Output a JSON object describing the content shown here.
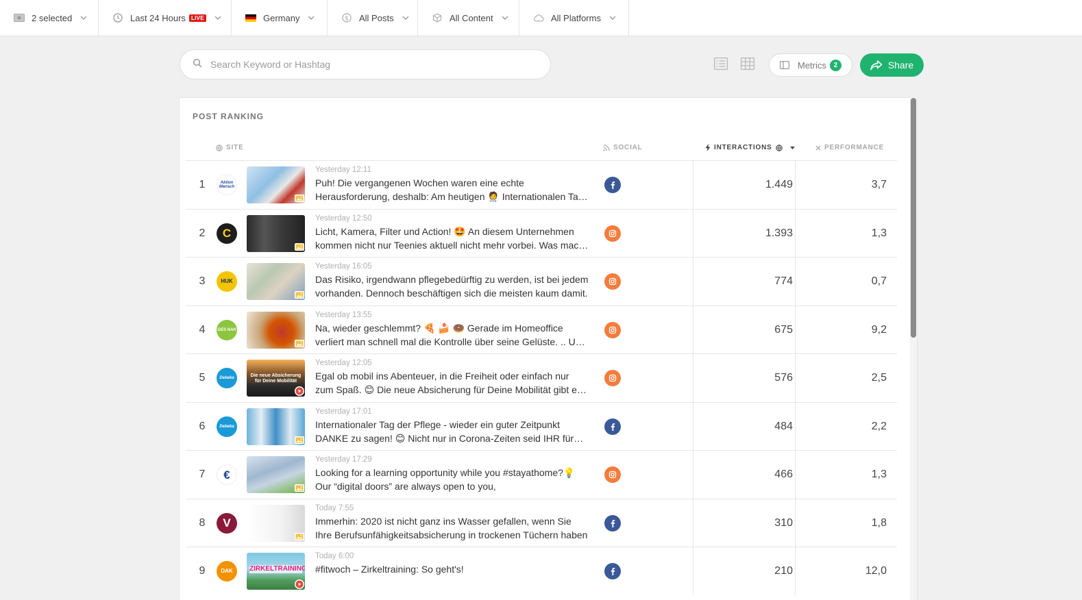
{
  "filters": [
    {
      "icon": "money-icon",
      "label": "2 selected",
      "live": false
    },
    {
      "icon": "clock-icon",
      "label": "Last 24 Hours",
      "live": true
    },
    {
      "icon": "germany-flag-icon",
      "label": "Germany",
      "live": false
    },
    {
      "icon": "dollar-icon",
      "label": "All Posts",
      "live": false
    },
    {
      "icon": "box-icon",
      "label": "All Content",
      "live": false
    },
    {
      "icon": "cloud-icon",
      "label": "All Platforms",
      "live": false
    }
  ],
  "live_label": "LIVE",
  "search": {
    "placeholder": "Search Keyword or Hashtag"
  },
  "metrics": {
    "label": "Metrics",
    "count": "2"
  },
  "share": {
    "label": "Share"
  },
  "panel": {
    "title": "POST RANKING"
  },
  "columns": {
    "site": "SITE",
    "social": "SOCIAL",
    "interactions": "INTERACTIONS",
    "performance": "PERFORMANCE"
  },
  "colors": {
    "accent": "#1fb36f",
    "facebook": "#3b5998",
    "instagram": "#f47c3c",
    "live": "#e01a1a"
  },
  "posts": [
    {
      "rank": "1",
      "site": "Aktion Mensch",
      "avatar_text": "Aktion Mensch",
      "avatar_bg": "#ffffff",
      "avatar_fg": "#2a4b9b",
      "thumb_type": "image",
      "thumb_bg": "linear-gradient(135deg,#cfe3f3 0%,#8fbfe3 40%,#e8e8e8 60%,#c0392b 75%,#dfe7ef 100%)",
      "time": "Yesterday 12:11",
      "text": "Puh! Die vergangenen Wochen waren eine echte Herausforderung, deshalb: Am heutigen 🧑‍⚕️ Internationalen Tag der Pflege möchten wir Danke sagen",
      "social": "facebook",
      "interactions": "1.449",
      "performance": "3,7"
    },
    {
      "rank": "2",
      "site": "Commerzbank",
      "avatar_text": "C",
      "avatar_bg": "#1d1d1d",
      "avatar_fg": "#f7d117",
      "thumb_type": "image",
      "thumb_bg": "linear-gradient(90deg,#2a2a2a 0%,#555 30%,#3a3a3a 60%,#222 100%)",
      "time": "Yesterday 12:50",
      "text": "Licht, Kamera, Filter und Action! 🤩 An diesem Unternehmen kommen nicht nur Teenies aktuell nicht mehr vorbei. Was macht TikTok so erfolgreich?",
      "social": "instagram",
      "interactions": "1.393",
      "performance": "1,3"
    },
    {
      "rank": "3",
      "site": "HUK-COBURG",
      "avatar_text": "HUK",
      "avatar_bg": "#f2c500",
      "avatar_fg": "#1b2a5c",
      "thumb_type": "image",
      "thumb_bg": "linear-gradient(135deg,#e9e3d6 0%,#b9c8b3 35%,#dcd2c2 60%,#7ea0b8 100%)",
      "time": "Yesterday 16:05",
      "text": "Das Risiko, irgendwann pflegebedürftig zu werden, ist bei jedem vorhanden. Dennoch beschäftigen sich die meisten kaum damit.",
      "social": "instagram",
      "interactions": "774",
      "performance": "0,7"
    },
    {
      "rank": "4",
      "site": "Gesund nah",
      "avatar_text": "GES NAH",
      "avatar_bg": "#8cc63f",
      "avatar_fg": "#ffffff",
      "thumb_type": "image",
      "thumb_bg": "radial-gradient(circle at 60% 55%,#c0392b 0%,#d35400 30%,#c9a77a 55%,#efe6d8 100%)",
      "time": "Yesterday 13:55",
      "text": "Na, wieder geschlemmt? 🍕 🍰 🍩 Gerade im Homeoffice verliert man schnell mal die Kontrolle über seine Gelüste. .. Um das zu vermeiden",
      "social": "instagram",
      "interactions": "675",
      "performance": "9,2"
    },
    {
      "rank": "5",
      "site": "Debeka",
      "avatar_text": "Debeka",
      "avatar_bg": "#1a9ad6",
      "avatar_fg": "#ffffff",
      "thumb_type": "video",
      "thumb_bg": "linear-gradient(180deg,#f3b25a 0%,#8a5a2b 35%,#2d2d2d 70%,#1a1a1a 100%)",
      "thumb_caption": "Die neue Absicherung für Deine Mobilität",
      "time": "Yesterday 12:05",
      "text": "Egal ob mobil ins Abenteuer, in die Freiheit oder einfach nur zum Spaß. 😊 Die neue Absicherung für Deine Mobilität gibt es jetzt",
      "social": "instagram",
      "interactions": "576",
      "performance": "2,5"
    },
    {
      "rank": "6",
      "site": "Debeka",
      "avatar_text": "Debeka",
      "avatar_bg": "#1a9ad6",
      "avatar_fg": "#ffffff",
      "thumb_type": "image",
      "thumb_bg": "linear-gradient(90deg,#6fb3d9 0%,#e4eef5 25%,#3f8fc5 50%,#dfeaf2 75%,#5aa7d6 100%)",
      "time": "Yesterday 17:01",
      "text": "Internationaler Tag der Pflege - wieder ein guter Zeitpunkt DANKE zu sagen! 😊 Nicht nur in Corona-Zeiten seid IHR für uns da",
      "social": "facebook",
      "interactions": "484",
      "performance": "2,2"
    },
    {
      "rank": "7",
      "site": "Europäische Zentralbank",
      "avatar_text": "€",
      "avatar_bg": "#ffffff",
      "avatar_fg": "#1b3c8a",
      "thumb_type": "image",
      "thumb_bg": "linear-gradient(160deg,#d8e3ee 0%,#9fb7cf 40%,#c7d4e1 60%,#8ec07a 85%,#6fae52 100%)",
      "time": "Yesterday 17:29",
      "text": "Looking for a learning opportunity while you #stayathome?💡 Our “digital doors” are always open to you,",
      "social": "instagram",
      "interactions": "466",
      "performance": "1,3"
    },
    {
      "rank": "8",
      "site": "Volksbank",
      "avatar_text": "V",
      "avatar_bg": "#8b1a3a",
      "avatar_fg": "#ffffff",
      "thumb_type": "image",
      "thumb_bg": "linear-gradient(90deg,#ffffff 0%,#f2f2f2 60%,#d9d9d9 100%)",
      "time": "Today 7:55",
      "text": "Immerhin: 2020 ist nicht ganz ins Wasser gefallen, wenn Sie Ihre Berufsunfähigkeitsabsicherung in trockenen Tüchern haben",
      "social": "facebook",
      "interactions": "310",
      "performance": "1,8"
    },
    {
      "rank": "9",
      "site": "DAK Gesundheit",
      "avatar_text": "DAK",
      "avatar_bg": "#f39200",
      "avatar_fg": "#ffffff",
      "thumb_type": "video",
      "thumb_bg": "linear-gradient(180deg,#7ec8e3 0%,#a6d8ea 45%,#4f9d5a 75%,#3c7d44 100%)",
      "thumb_caption": "ZIRKELTRAINING",
      "time": "Today 6:00",
      "text": "#fitwoch – Zirkeltraining: So geht's!",
      "social": "facebook",
      "interactions": "210",
      "performance": "12,0"
    }
  ]
}
